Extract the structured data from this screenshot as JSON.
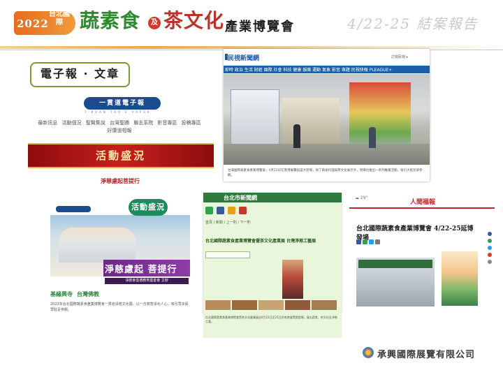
{
  "header": {
    "year": "2022",
    "city": "台北國際",
    "title_part1": "蔬素食",
    "title_and": "及",
    "title_part2": "茶文化",
    "subtitle": "產業博覽會",
    "right_text": "4/22-25 結案報告"
  },
  "section_label": "電子報 · 文章",
  "newsletter": {
    "logo": "一貫道電子報",
    "logo_sub": "I-KUAN TAO E PAPER",
    "nav_row1": "最新訊息  活動個況  聖賢集說  台灣聖蹟  聯志系院  影音專區  投稿專區",
    "nav_row2": "好康道相報",
    "banner": "活動盛況",
    "link": "淨慈慮起菩提行"
  },
  "clip_top_right": {
    "site": "民視新聞網",
    "meta": "訂閱民視 ▸",
    "nav": "即時 政治 生活 財經 國際 社會 科技 健康 娛樂 運動 氣象 影音 專題 民視快報 PLEAGUE+",
    "caption": "台灣國際蔬素食產業博覽會，4月22日在南港展覽館盛大登場，除了蔬食料理與茶文化展示外，現場也推出一系列推廣活動，吸引大批民眾參觀。"
  },
  "clip_bottom_left": {
    "badge": "活動盛況",
    "banner": "淨慈慮起 菩提行",
    "banner_sub": "淨慈會善德教育基金會 主辦",
    "title_a": "基緣興寺",
    "title_b": "台灣佛教",
    "text": "2022年台北國際蔬素食產業博覽會一貫道淨慈文化展，以一方慈悲淨化人心，吸引眾多民眾駐足參觀。"
  },
  "clip_bottom_center": {
    "site": "台北市新聞網",
    "meta": "首頁 / 新聞 / 上一則 / 下一則",
    "title": "台北國際蔬素食產業博覽會暨茶文化產業展 台灣淨慈工藝展",
    "text": "台北國際蔬素食產業博覽會暨茶文化產業展自4月22日至25日於南港展覽館登場，展出蔬食、茶文化及淨慈工藝。"
  },
  "clip_bottom_right": {
    "logo": "人間福報",
    "weather": "☁ 29°",
    "title": "台北國際蔬素食產業博覽會 4/22-25延博發場"
  },
  "footer": {
    "company": "承興國際展覽有限公司"
  }
}
